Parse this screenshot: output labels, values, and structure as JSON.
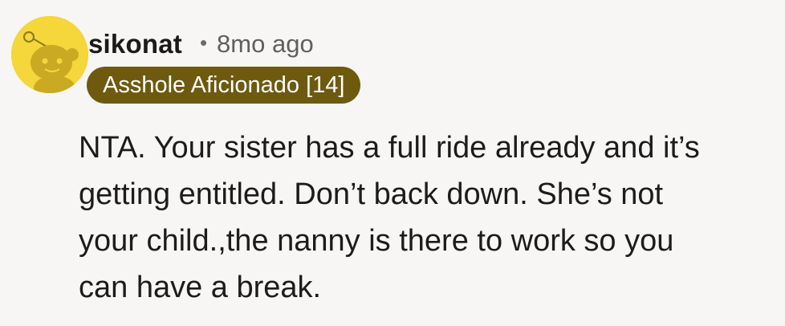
{
  "comment": {
    "avatar_icon": "reddit-snoo-avatar-icon",
    "avatar_color": "#f5d63b",
    "username": "sikonat",
    "separator": "•",
    "timestamp": "8mo ago",
    "flair": {
      "text": "Asshole Aficionado [14]",
      "background": "#6e5a0f"
    },
    "body_lines": [
      "NTA. Your sister has a full ride already and it’s",
      "getting entitled. Don’t back down. She’s not",
      "your child.,the nanny is there to work so you",
      "can have a break."
    ]
  }
}
